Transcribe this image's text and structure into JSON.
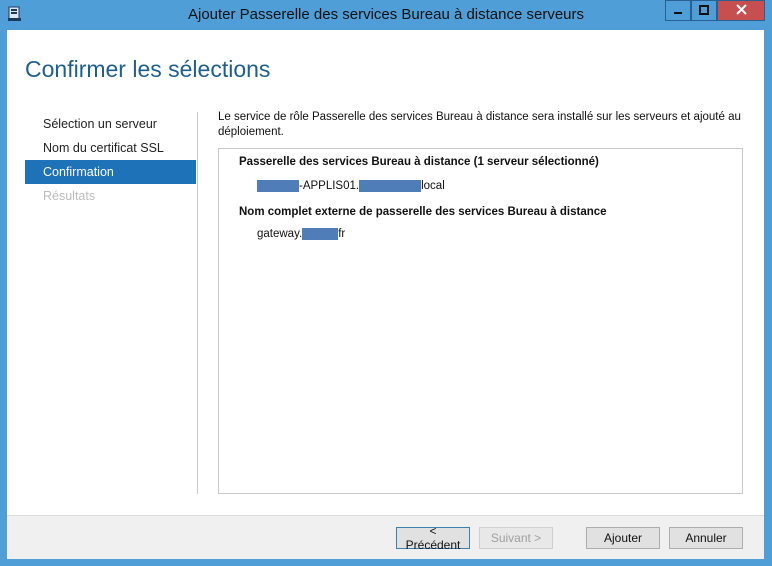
{
  "window": {
    "title": "Ajouter Passerelle des services Bureau à distance serveurs",
    "controls": {
      "minimize": "–",
      "maximize": "□",
      "close": "✕"
    }
  },
  "page": {
    "title": "Confirmer les sélections"
  },
  "nav": {
    "items": [
      {
        "label": "Sélection un serveur",
        "state": "normal"
      },
      {
        "label": "Nom du certificat SSL",
        "state": "normal"
      },
      {
        "label": "Confirmation",
        "state": "active"
      },
      {
        "label": "Résultats",
        "state": "disabled"
      }
    ]
  },
  "content": {
    "intro": "Le service de rôle Passerelle des services Bureau à distance sera installé sur les serveurs et ajouté au déploiement.",
    "section1": {
      "heading": "Passerelle des services Bureau à distance  (1 serveur sélectionné)",
      "value_mid": "-APPLIS01.",
      "value_end": "local"
    },
    "section2": {
      "heading": "Nom complet externe de passerelle des services Bureau à distance",
      "value_start": "gateway.",
      "value_end": "fr"
    }
  },
  "footer": {
    "previous": "< Précédent",
    "next": "Suivant >",
    "add": "Ajouter",
    "cancel": "Annuler"
  },
  "colors": {
    "titlebar": "#4f9ed8",
    "accent": "#1e72b8",
    "title_text": "#1e5f8e",
    "close": "#c74f4f",
    "redaction": "#4f7db8"
  }
}
